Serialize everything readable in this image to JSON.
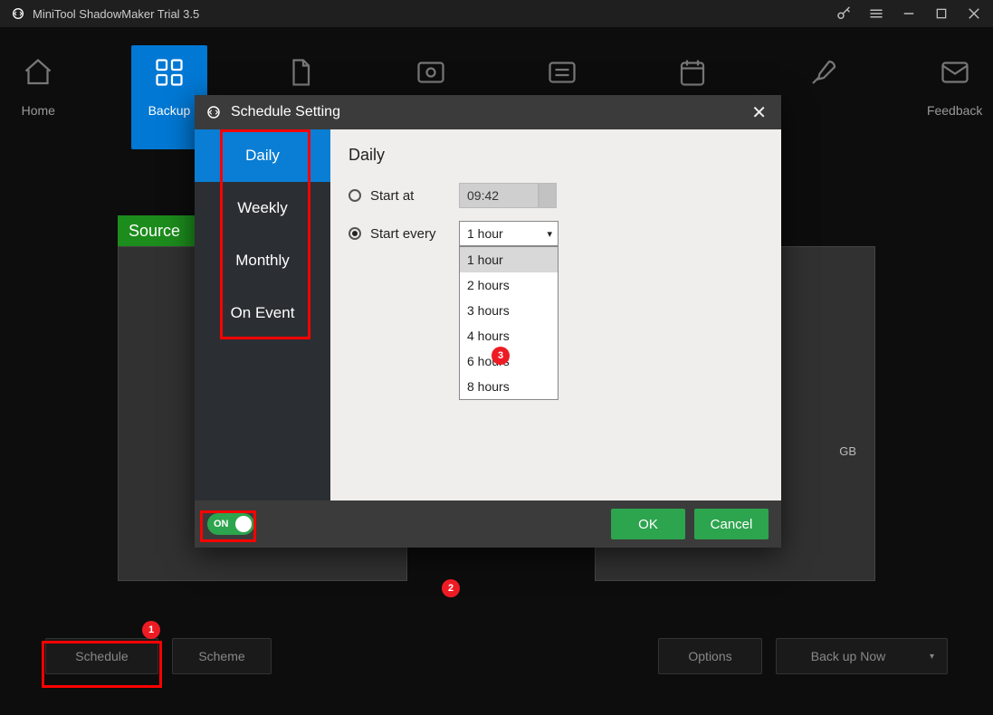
{
  "titlebar": {
    "title": "MiniTool ShadowMaker Trial 3.5"
  },
  "nav": {
    "items": [
      {
        "label": "Home"
      },
      {
        "label": "Backup"
      },
      {
        "label": ""
      },
      {
        "label": ""
      },
      {
        "label": ""
      },
      {
        "label": ""
      },
      {
        "label": ""
      },
      {
        "label": "Feedback"
      }
    ]
  },
  "source": {
    "label": "Source"
  },
  "dest": {
    "gb_suffix": "GB"
  },
  "bottom": {
    "schedule": "Schedule",
    "scheme": "Scheme",
    "options": "Options",
    "backup_now": "Back up Now"
  },
  "modal": {
    "title": "Schedule Setting",
    "tabs": [
      {
        "label": "Daily"
      },
      {
        "label": "Weekly"
      },
      {
        "label": "Monthly"
      },
      {
        "label": "On Event"
      }
    ],
    "content_title": "Daily",
    "start_at_label": "Start at",
    "start_at_time": "09:42",
    "start_every_label": "Start every",
    "start_every_selected": "1 hour",
    "dropdown_options": [
      "1 hour",
      "2 hours",
      "3 hours",
      "4 hours",
      "6 hours",
      "8 hours"
    ],
    "toggle_label": "ON",
    "ok": "OK",
    "cancel": "Cancel"
  },
  "annotations": {
    "b1": "1",
    "b2": "2",
    "b3": "3"
  }
}
